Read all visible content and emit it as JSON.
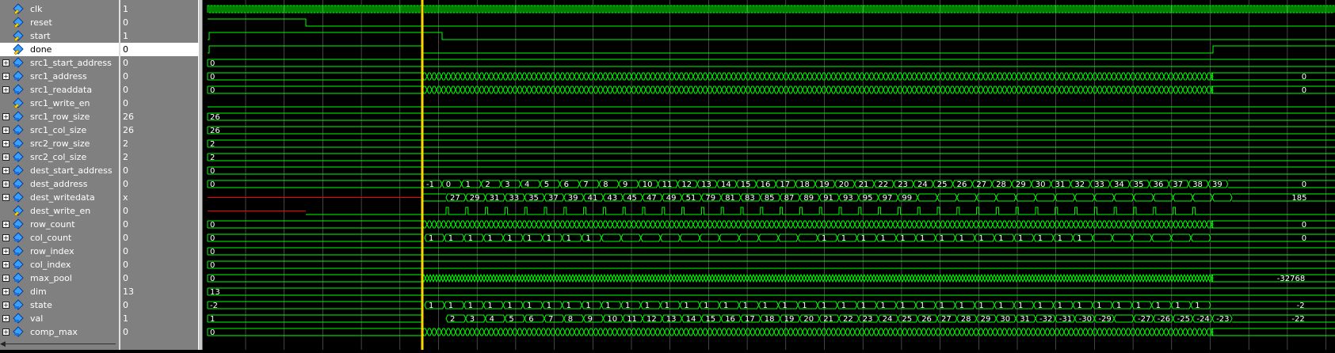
{
  "signals": [
    {
      "name": "clk",
      "value": "1",
      "expandable": false
    },
    {
      "name": "reset",
      "value": "0",
      "expandable": false
    },
    {
      "name": "start",
      "value": "1",
      "expandable": false
    },
    {
      "name": "done",
      "value": "0",
      "expandable": false,
      "selected": true
    },
    {
      "name": "src1_start_address",
      "value": "0",
      "expandable": true
    },
    {
      "name": "src1_address",
      "value": "0",
      "expandable": true
    },
    {
      "name": "src1_readdata",
      "value": "0",
      "expandable": true
    },
    {
      "name": "src1_write_en",
      "value": "0",
      "expandable": false
    },
    {
      "name": "src1_row_size",
      "value": "26",
      "expandable": true
    },
    {
      "name": "src1_col_size",
      "value": "26",
      "expandable": true
    },
    {
      "name": "src2_row_size",
      "value": "2",
      "expandable": true
    },
    {
      "name": "src2_col_size",
      "value": "2",
      "expandable": true
    },
    {
      "name": "dest_start_address",
      "value": "0",
      "expandable": true
    },
    {
      "name": "dest_address",
      "value": "0",
      "expandable": true
    },
    {
      "name": "dest_writedata",
      "value": "x",
      "expandable": true
    },
    {
      "name": "dest_write_en",
      "value": "0",
      "expandable": false
    },
    {
      "name": "row_count",
      "value": "0",
      "expandable": true
    },
    {
      "name": "col_count",
      "value": "0",
      "expandable": true
    },
    {
      "name": "row_index",
      "value": "0",
      "expandable": true
    },
    {
      "name": "col_index",
      "value": "0",
      "expandable": true
    },
    {
      "name": "max_pool",
      "value": "0",
      "expandable": true
    },
    {
      "name": "dim",
      "value": "13",
      "expandable": true
    },
    {
      "name": "state",
      "value": "0",
      "expandable": true
    },
    {
      "name": "val",
      "value": "1",
      "expandable": true
    },
    {
      "name": "comp_max",
      "value": "0",
      "expandable": true
    }
  ],
  "waves": {
    "init_labels": {
      "src1_start_address": "0",
      "src1_address": "0",
      "src1_readdata": "0",
      "src1_row_size": "26",
      "src1_col_size": "26",
      "src2_row_size": "2",
      "src2_col_size": "2",
      "dest_start_address": "0",
      "dest_address": "0",
      "row_count": "0",
      "col_count": "0",
      "row_index": "0",
      "col_index": "0",
      "max_pool": "0",
      "dim": "13",
      "state": "-2",
      "val": "1",
      "comp_max": "0"
    },
    "end_labels": {
      "src1_address": "0",
      "src1_readdata": "0",
      "dest_address": "0",
      "dest_writedata": "185",
      "row_count": "0",
      "col_count": "0",
      "max_pool": "-32768",
      "state": "-2",
      "val": "-22"
    },
    "dest_address_labels": [
      "-1",
      "0",
      "1",
      "2",
      "3",
      "4",
      "5",
      "6",
      "7",
      "8",
      "9",
      "10",
      "11",
      "12",
      "13",
      "14",
      "15",
      "16",
      "17",
      "18",
      "19",
      "20",
      "21",
      "22",
      "23",
      "24",
      "25",
      "26",
      "27",
      "28",
      "29",
      "30",
      "31",
      "32",
      "33",
      "34",
      "35",
      "36",
      "37",
      "38",
      "39"
    ],
    "dest_writedata_labels": [
      "27",
      "29",
      "31",
      "33",
      "35",
      "37",
      "39",
      "41",
      "43",
      "45",
      "47",
      "49",
      "51",
      "79",
      "81",
      "83",
      "85",
      "87",
      "89",
      "91",
      "93",
      "95",
      "97",
      "99",
      "",
      "",
      "",
      "",
      "",
      "",
      "",
      "",
      "",
      "",
      "",
      "",
      "",
      "",
      "",
      ""
    ],
    "val_labels": [
      "2",
      "3",
      "4",
      "5",
      "6",
      "7",
      "8",
      "9",
      "10",
      "11",
      "12",
      "13",
      "14",
      "15",
      "16",
      "17",
      "18",
      "19",
      "20",
      "21",
      "22",
      "23",
      "24",
      "25",
      "26",
      "27",
      "28",
      "29",
      "30",
      "31",
      "-32",
      "-31",
      "-30",
      "-29",
      "",
      "-27",
      "-26",
      "-25",
      "-24",
      "-23"
    ],
    "state_labels": [
      "1",
      "1",
      "1",
      "1",
      "1",
      "1",
      "1",
      "1",
      "1",
      "1",
      "1",
      "1",
      "1",
      "1",
      "1",
      "1",
      "1",
      "1",
      "1",
      "1",
      "1",
      "1",
      "1",
      "1",
      "1",
      "1",
      "1",
      "1",
      "1",
      "1",
      "1",
      "1",
      "1",
      "1",
      "1",
      "1",
      "1",
      "1",
      "1",
      "1"
    ],
    "col_count_labels": [
      "1",
      "1",
      "1",
      "1",
      "1",
      "1",
      "1",
      "1",
      "1",
      "",
      "",
      "",
      "",
      "",
      "",
      "",
      "",
      "",
      "",
      "",
      "1",
      "1",
      "1",
      "1",
      "1",
      "1",
      "1",
      "1",
      "1",
      "1",
      "1",
      "1",
      "1",
      "1",
      "",
      "",
      "",
      "",
      "",
      ""
    ]
  },
  "colors": {
    "wave": "#00ff00",
    "x_state": "#ff0000",
    "cursor": "#ffd700",
    "grid": "#ffffff",
    "panel": "#808080",
    "selected_row": "#ffffff"
  }
}
